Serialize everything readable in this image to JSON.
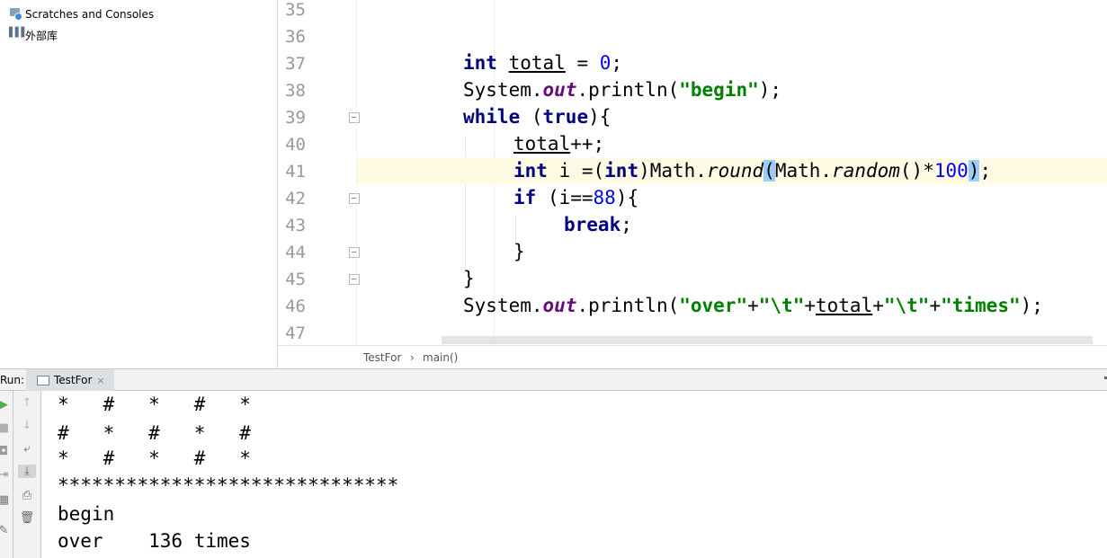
{
  "project_tree": {
    "items": [
      {
        "label": "Scratches and Consoles",
        "icon": "scratches-icon"
      },
      {
        "label": "外部库",
        "icon": "library-icon"
      }
    ]
  },
  "editor": {
    "line_numbers": [
      "35",
      "36",
      "37",
      "38",
      "39",
      "40",
      "41",
      "42",
      "43",
      "44",
      "45",
      "46",
      "47"
    ],
    "current_line": "41",
    "colors": {
      "keyword": "#000080",
      "field": "#660e7a",
      "string": "#008000",
      "number": "#0000ff",
      "current_line_bg": "#fffae3",
      "brace_match": "#99ccff"
    },
    "code": {
      "l37": {
        "kw_int": "int",
        "var": "total",
        "eq": " = ",
        "num": "0",
        "end": ";"
      },
      "l38": {
        "sys": "System.",
        "field": "out",
        "call": ".println(",
        "str": "\"begin\"",
        "end": ");"
      },
      "l39": {
        "kw_while": "while",
        "open": " (",
        "kw_true": "true",
        "close": "){"
      },
      "l40": {
        "var": "total",
        "rest": "++;"
      },
      "l41": {
        "kw_int": "int",
        "mid": " i =(",
        "kw_int2": "int",
        "cast": ")Math.",
        "round": "round",
        "paren1": "(",
        "math2": "Math.",
        "random": "random",
        "mult": "()*",
        "num": "100",
        "paren2": ")",
        "end": ";"
      },
      "l42": {
        "kw_if": "if",
        "open": " (i==",
        "num": "88",
        "close": "){"
      },
      "l43": {
        "kw_break": "break",
        "end": ";"
      },
      "l44": {
        "brace": "}"
      },
      "l45": {
        "brace": "}"
      },
      "l46": {
        "sys": "System.",
        "field": "out",
        "call": ".println(",
        "s1": "\"over\"",
        "p1": "+",
        "s2": "\"\\t\"",
        "p2": "+",
        "var": "total",
        "p3": "+",
        "s3": "\"\\t\"",
        "p4": "+",
        "s4": "\"times\"",
        "end": ");"
      }
    }
  },
  "breadcrumb": {
    "class_name": "TestFor",
    "separator": "›",
    "method": "main()"
  },
  "run": {
    "label": "Run:",
    "tab_label": "TestFor",
    "tab_close": "×",
    "console_lines": [
      "*   #   *   #   *",
      "#   *   #   *   #",
      "*   #   *   #   *",
      "******************************",
      "begin",
      "over    136 times"
    ]
  }
}
